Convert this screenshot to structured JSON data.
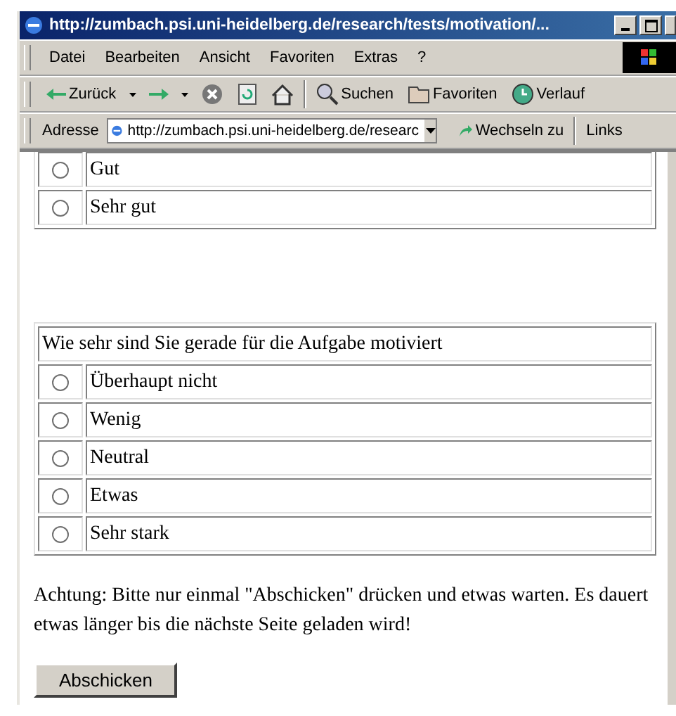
{
  "window": {
    "title": "http://zumbach.psi.uni-heidelberg.de/research/tests/motivation/..."
  },
  "menu": [
    "Datei",
    "Bearbeiten",
    "Ansicht",
    "Favoriten",
    "Extras",
    "?"
  ],
  "toolbar": [
    {
      "kind": "back",
      "label": "Zurück"
    },
    {
      "kind": "dropdown"
    },
    {
      "kind": "forward"
    },
    {
      "kind": "dropdown"
    },
    {
      "kind": "stop"
    },
    {
      "kind": "refresh"
    },
    {
      "kind": "home"
    },
    {
      "kind": "separator"
    },
    {
      "kind": "search",
      "label": "Suchen"
    },
    {
      "kind": "favorites",
      "label": "Favoriten"
    },
    {
      "kind": "history",
      "label": "Verlauf"
    }
  ],
  "address": {
    "label": "Adresse",
    "value": "http://zumbach.psi.uni-heidelberg.de/researc",
    "go": "Wechseln zu",
    "links": "Links"
  },
  "questions": [
    {
      "options": [
        {
          "label": "Gut",
          "selected": false
        },
        {
          "label": "Sehr gut",
          "selected": false
        }
      ]
    },
    {
      "prompt": "Wie sehr sind Sie gerade für die Aufgabe motiviert",
      "options": [
        {
          "label": "Überhaupt nicht",
          "selected": false
        },
        {
          "label": "Wenig",
          "selected": false
        },
        {
          "label": "Neutral",
          "selected": false
        },
        {
          "label": "Etwas",
          "selected": false
        },
        {
          "label": "Sehr stark",
          "selected": false
        }
      ]
    }
  ],
  "notice": "Achtung: Bitte nur einmal \"Abschicken\" drücken und etwas warten. Es dauert etwas länger bis die nächste Seite geladen wird!",
  "submit": "Abschicken"
}
